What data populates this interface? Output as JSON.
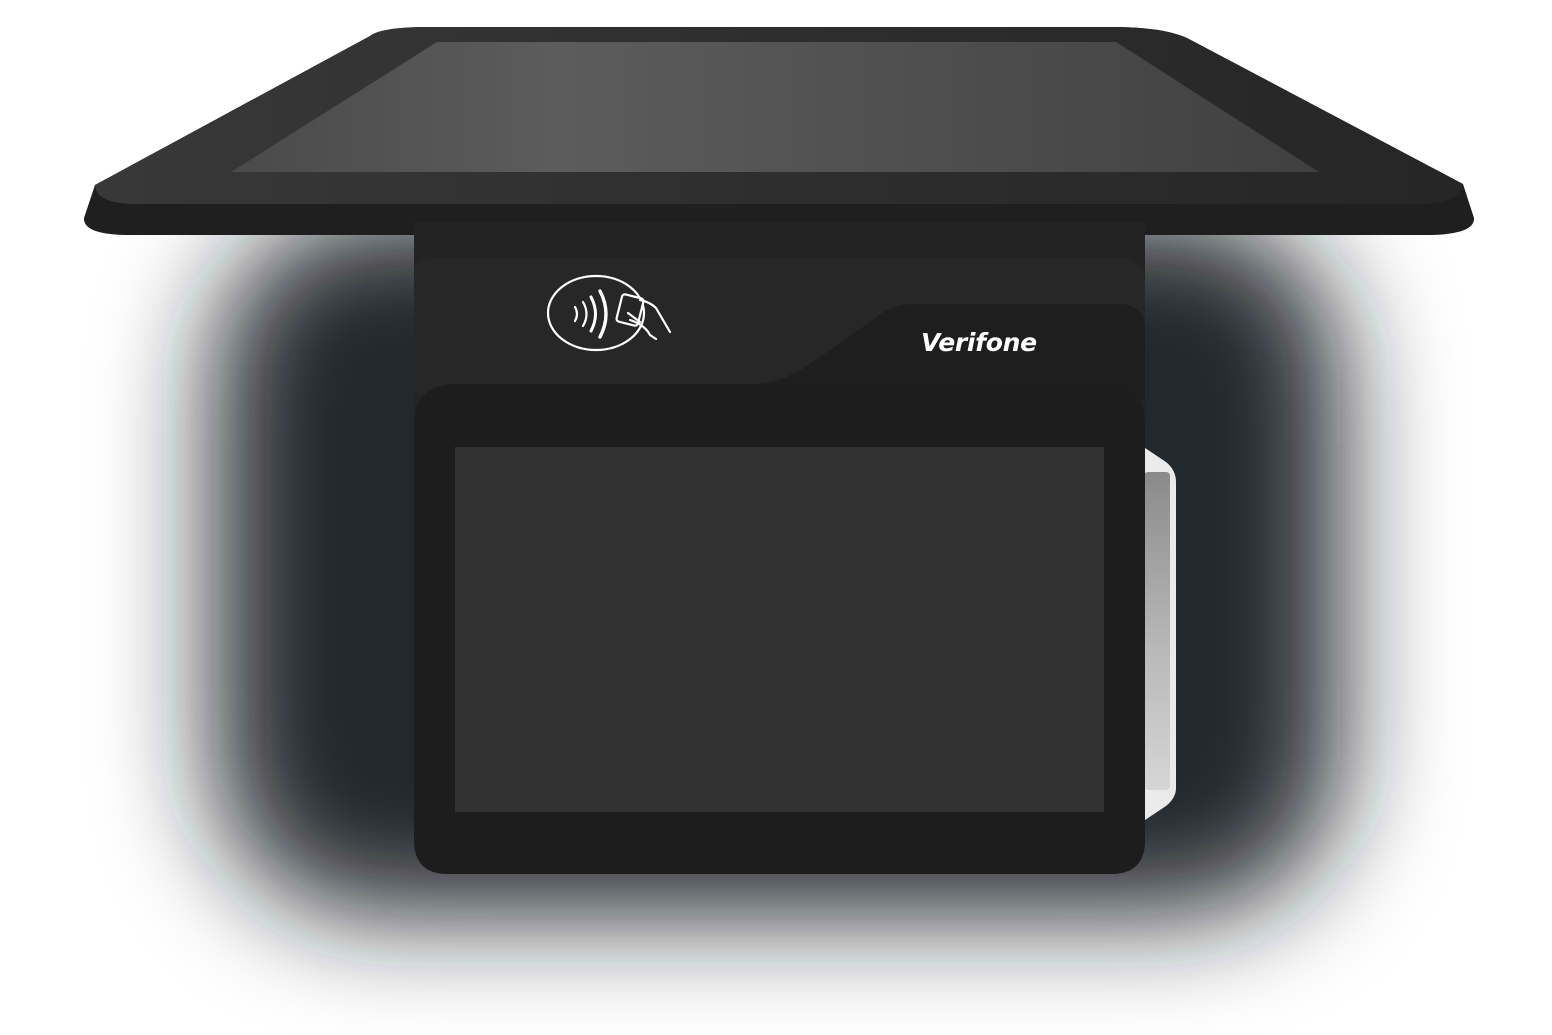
{
  "device": {
    "brand": "Verifone",
    "contactless_icon": "contactless-payment-icon",
    "colors": {
      "background": "#ffffff",
      "body": "#262626",
      "bezel": "#1e1d1d",
      "screen": "#323232",
      "top_display": "#595959",
      "brand_text": "#ffffff"
    }
  }
}
